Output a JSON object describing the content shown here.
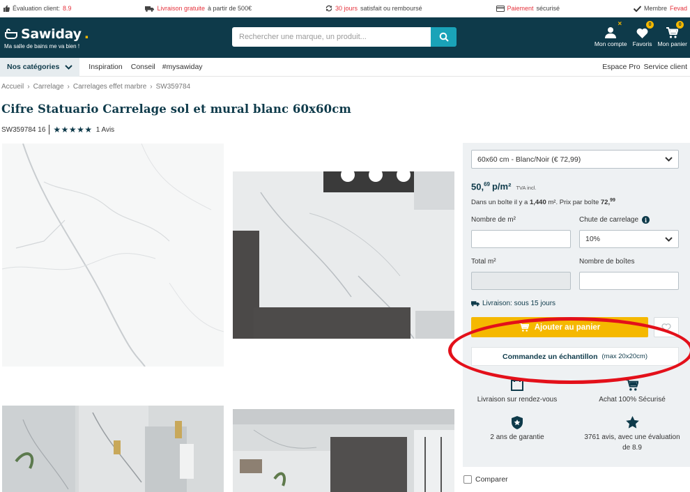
{
  "trustbar": {
    "rating_label": "Évaluation client:",
    "rating_value": "8.9",
    "delivery_red": "Livraison gratuite",
    "delivery_rest": "à partir de 500€",
    "return_red": "30 jours",
    "return_rest": "satisfait ou remboursé",
    "payment_red": "Paiement",
    "payment_rest": "sécurisé",
    "member_label": "Membre",
    "member_red": "Fevad"
  },
  "header": {
    "brand": "Sawiday",
    "tagline": "Ma salle de bains me va bien !",
    "search_placeholder": "Rechercher une marque, un produit...",
    "account": "Mon compte",
    "favorites": "Favoris",
    "favorites_count": "0",
    "cart": "Mon panier",
    "cart_count": "0"
  },
  "nav": {
    "categories": "Nos catégories",
    "links": [
      "Inspiration",
      "Conseil",
      "#mysawiday"
    ],
    "right": [
      "Espace Pro",
      "Service client"
    ]
  },
  "breadcrumb": [
    "Accueil",
    "Carrelage",
    "Carrelages effet marbre",
    "SW359784"
  ],
  "product": {
    "title": "Cifre Statuario Carrelage sol et mural blanc 60x60cm",
    "sku": "SW359784 16",
    "stars": "★★★★★",
    "reviews": "1 Avis"
  },
  "panel": {
    "variant": "60x60 cm - Blanc/Noir (€ 72,99)",
    "price_main": "50,",
    "price_cents": "69",
    "price_unit": "p/m²",
    "price_tva": "TVA incl.",
    "box_prefix": "Dans un boîte il y a ",
    "box_m2": "1,440",
    "box_mid": " m². Prix par boîte ",
    "box_price": "72,",
    "box_price_cents": "99",
    "label_m2": "Nombre de m²",
    "label_waste": "Chute de carrelage",
    "waste_value": "10%",
    "label_total": "Total m²",
    "label_boxes": "Nombre de boîtes",
    "delivery": "Livraison: sous 15 jours",
    "add_to_cart": "Ajouter au panier",
    "sample_bold": "Commandez un échantillon",
    "sample_small": "(max 20x20cm)",
    "features": [
      "Livraison sur rendez-vous",
      "Achat 100% Sécurisé",
      "2 ans de garantie",
      "3761 avis, avec une évaluation de 8.9"
    ]
  },
  "compare": "Comparer",
  "colors": {
    "brand": "#0e3a4a",
    "accent": "#f5b800",
    "search_btn": "#1aa3b8",
    "highlight": "#e3101a"
  }
}
